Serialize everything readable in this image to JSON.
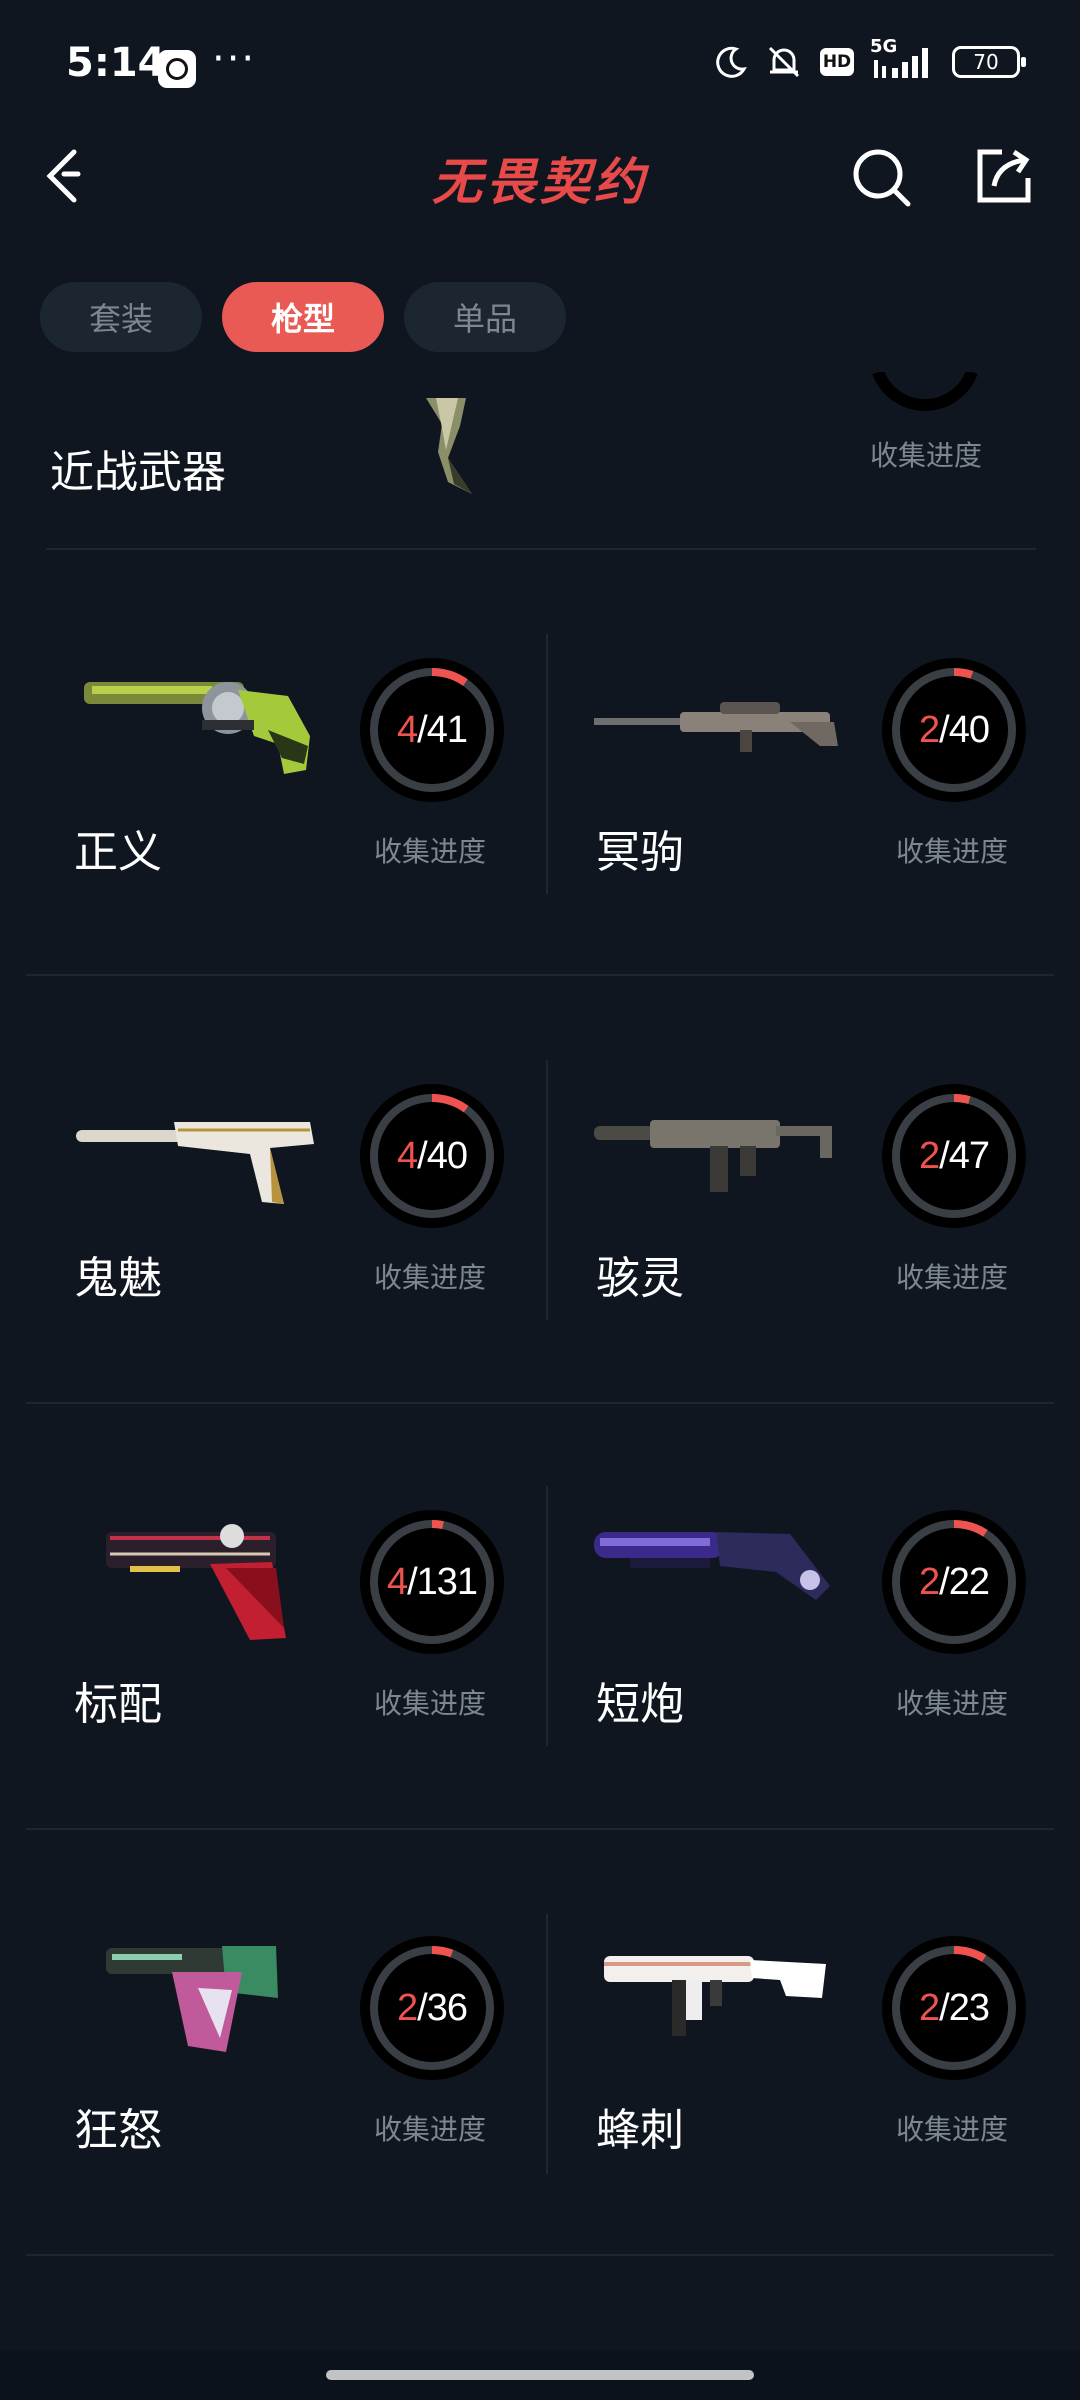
{
  "status_bar": {
    "time": "5:14",
    "more": "···",
    "network": "5G",
    "hd": "HD",
    "battery": "70"
  },
  "header": {
    "title": "无畏契约"
  },
  "tabs": [
    {
      "label": "套装",
      "active": false
    },
    {
      "label": "枪型",
      "active": true
    },
    {
      "label": "单品",
      "active": false
    }
  ],
  "melee": {
    "name": "近战武器",
    "progress_label": "收集进度"
  },
  "weapons": [
    {
      "name": "正义",
      "owned": "4",
      "total": "/41",
      "progress_label": "收集进度",
      "fraction": 0.0976
    },
    {
      "name": "冥驹",
      "owned": "2",
      "total": "/40",
      "progress_label": "收集进度",
      "fraction": 0.05
    },
    {
      "name": "鬼魅",
      "owned": "4",
      "total": "/40",
      "progress_label": "收集进度",
      "fraction": 0.1
    },
    {
      "name": "骇灵",
      "owned": "2",
      "total": "/47",
      "progress_label": "收集进度",
      "fraction": 0.0426
    },
    {
      "name": "标配",
      "owned": "4",
      "total": "/131",
      "progress_label": "收集进度",
      "fraction": 0.0305
    },
    {
      "name": "短炮",
      "owned": "2",
      "total": "/22",
      "progress_label": "收集进度",
      "fraction": 0.0909
    },
    {
      "name": "狂怒",
      "owned": "2",
      "total": "/36",
      "progress_label": "收集进度",
      "fraction": 0.0556
    },
    {
      "name": "蜂刺",
      "owned": "2",
      "total": "/23",
      "progress_label": "收集进度",
      "fraction": 0.087
    }
  ],
  "colors": {
    "background": "#101620",
    "accent": "#e95a55",
    "ring_track": "#3a3f45",
    "ring_fill": "#ef5350"
  }
}
